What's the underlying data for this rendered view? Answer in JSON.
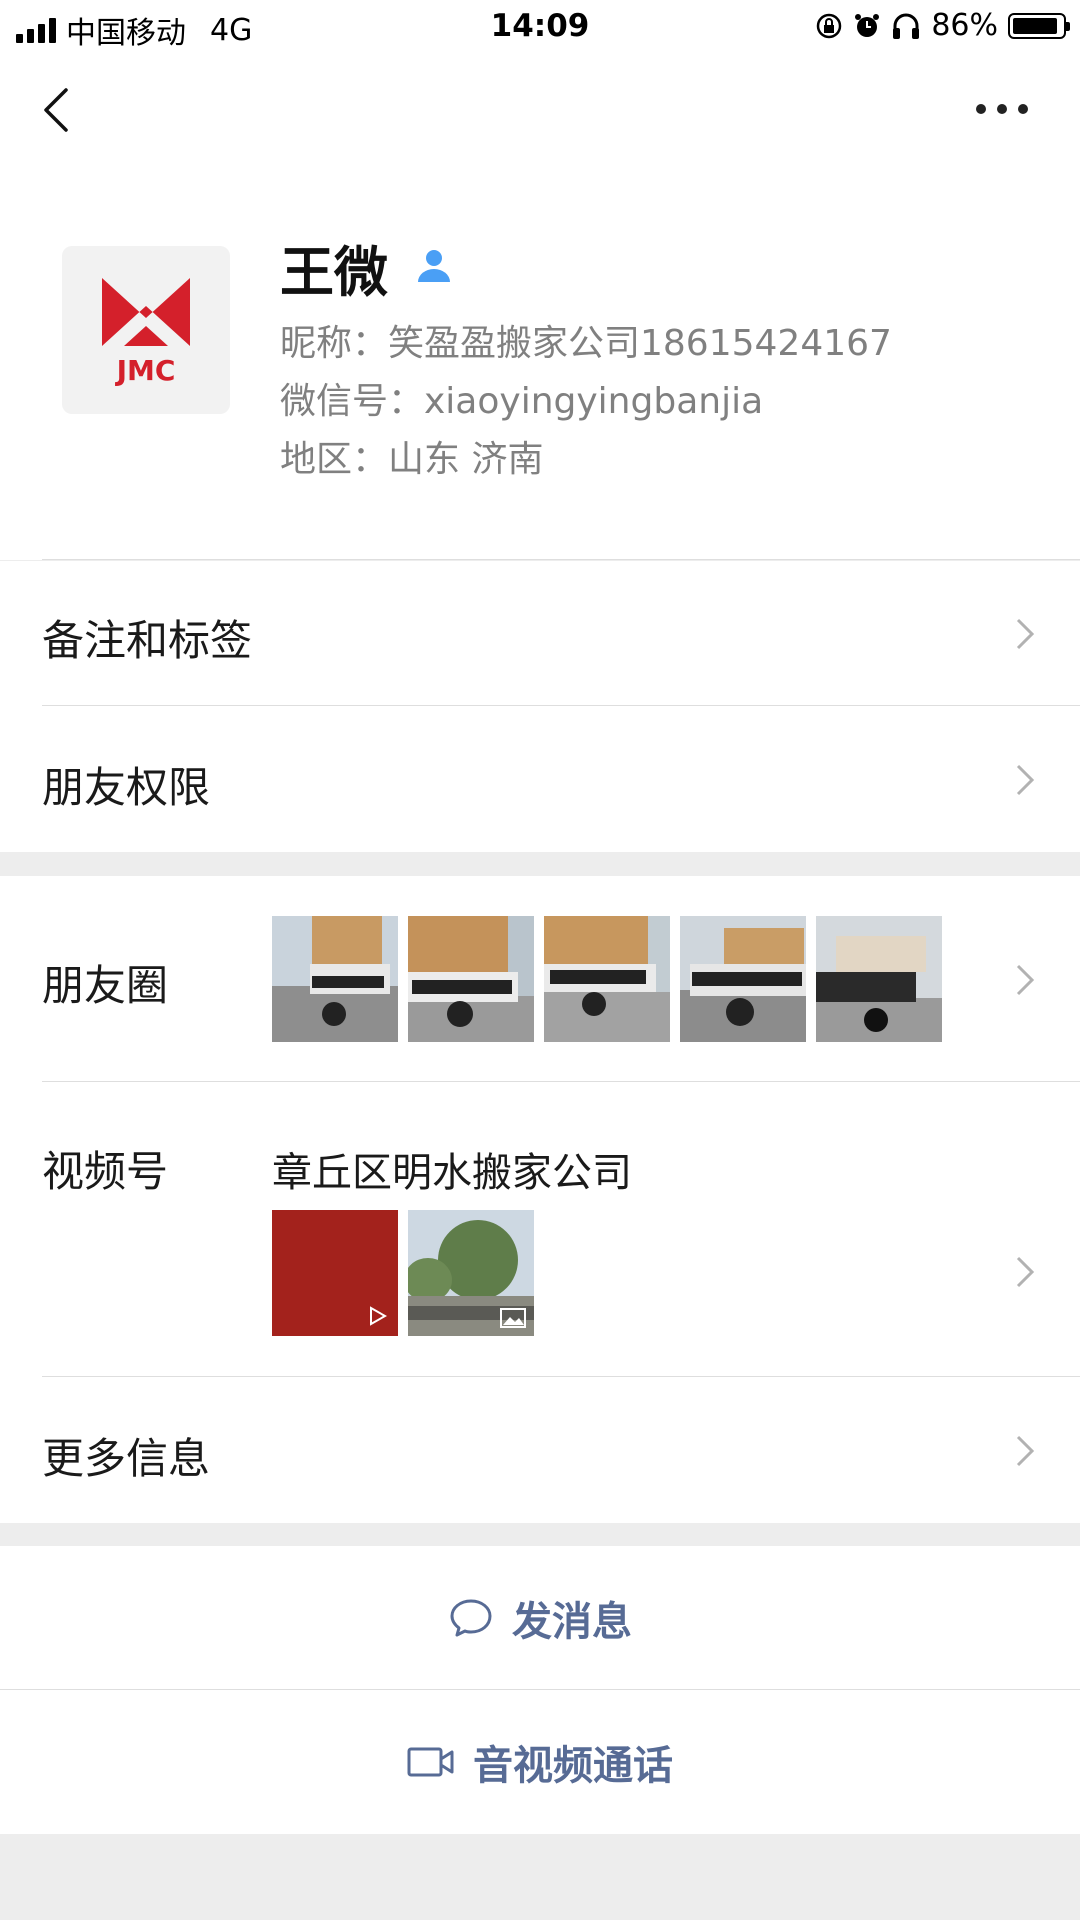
{
  "status_bar": {
    "carrier": "中国移动",
    "network": "4G",
    "time": "14:09",
    "battery": "86%"
  },
  "profile": {
    "name": "王微",
    "nickname": "昵称：笑盈盈搬家公司18615424167",
    "wechat_id": "微信号：xiaoyingyingbanjia",
    "region": "地区：山东 济南",
    "avatar_text": "JMC"
  },
  "menu": {
    "remarks_tags": "备注和标签",
    "friend_permissions": "朋友权限",
    "moments": "朋友圈",
    "channels": "视频号",
    "channels_name": "章丘区明水搬家公司",
    "more_info": "更多信息"
  },
  "actions": {
    "send_message": "发消息",
    "video_call": "音视频通话"
  },
  "colors": {
    "link": "#576b95",
    "jmc_red": "#d4202b",
    "video_thumb_red": "#a3221c"
  }
}
